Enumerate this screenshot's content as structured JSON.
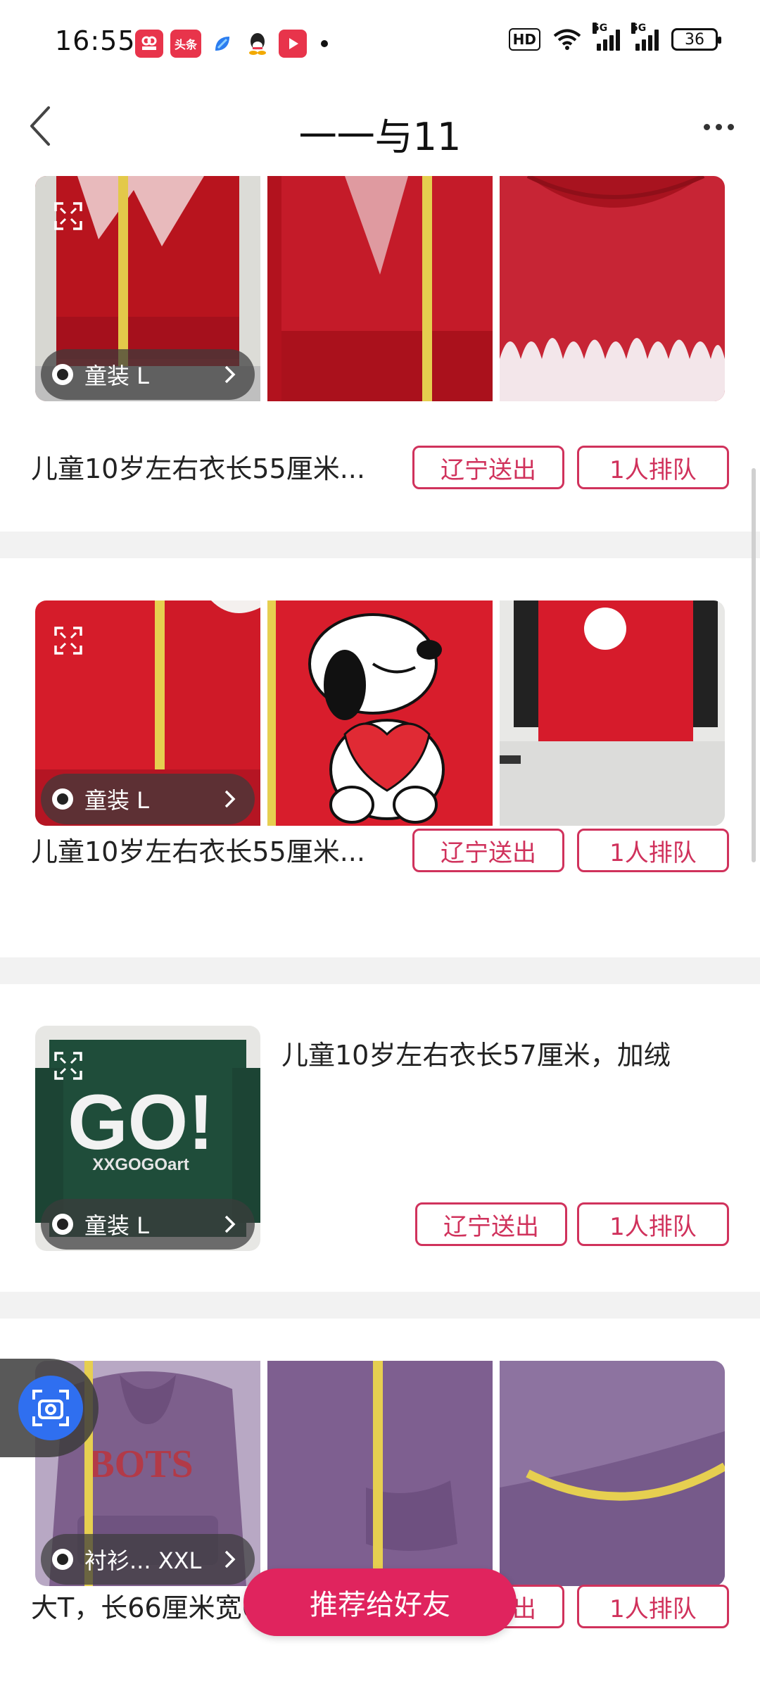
{
  "status_bar": {
    "time": "16:55",
    "notifications": [
      {
        "icon": "app-red-icon",
        "label": "",
        "color": "#e8344b"
      },
      {
        "icon": "toutiao-icon",
        "label": "头条",
        "color": "#e8344b"
      },
      {
        "icon": "blue-app-icon",
        "label": "",
        "color": "#2b7df0"
      },
      {
        "icon": "qq-icon",
        "label": "",
        "color": "#222222"
      },
      {
        "icon": "video-app-icon",
        "label": "",
        "color": "#e8344b"
      }
    ],
    "hd_label": "HD",
    "signal_tag_1": "5G",
    "signal_tag_2": "5G",
    "battery": "36"
  },
  "header": {
    "title": "一一与11"
  },
  "items": [
    {
      "description": "儿童10岁左右衣长55厘米...",
      "category": "童装 L",
      "location_button": "辽宁送出",
      "queue_button": "1人排队"
    },
    {
      "description": "儿童10岁左右衣长55厘米...",
      "category": "童装 L",
      "location_button": "辽宁送出",
      "queue_button": "1人排队"
    },
    {
      "description": "儿童10岁左右衣长57厘米，加绒",
      "category": "童装 L",
      "location_button": "辽宁送出",
      "queue_button": "1人排队"
    },
    {
      "description": "大T，长66厘米宽62厘米适...",
      "category": "衬衫... XXL",
      "location_button": "辽宁送出",
      "queue_button": "1人排队"
    }
  ],
  "recommend_button": "推荐给好友",
  "colors": {
    "accent": "#d0325c",
    "recommend": "#e0245e",
    "camera": "#2f6ff0"
  }
}
